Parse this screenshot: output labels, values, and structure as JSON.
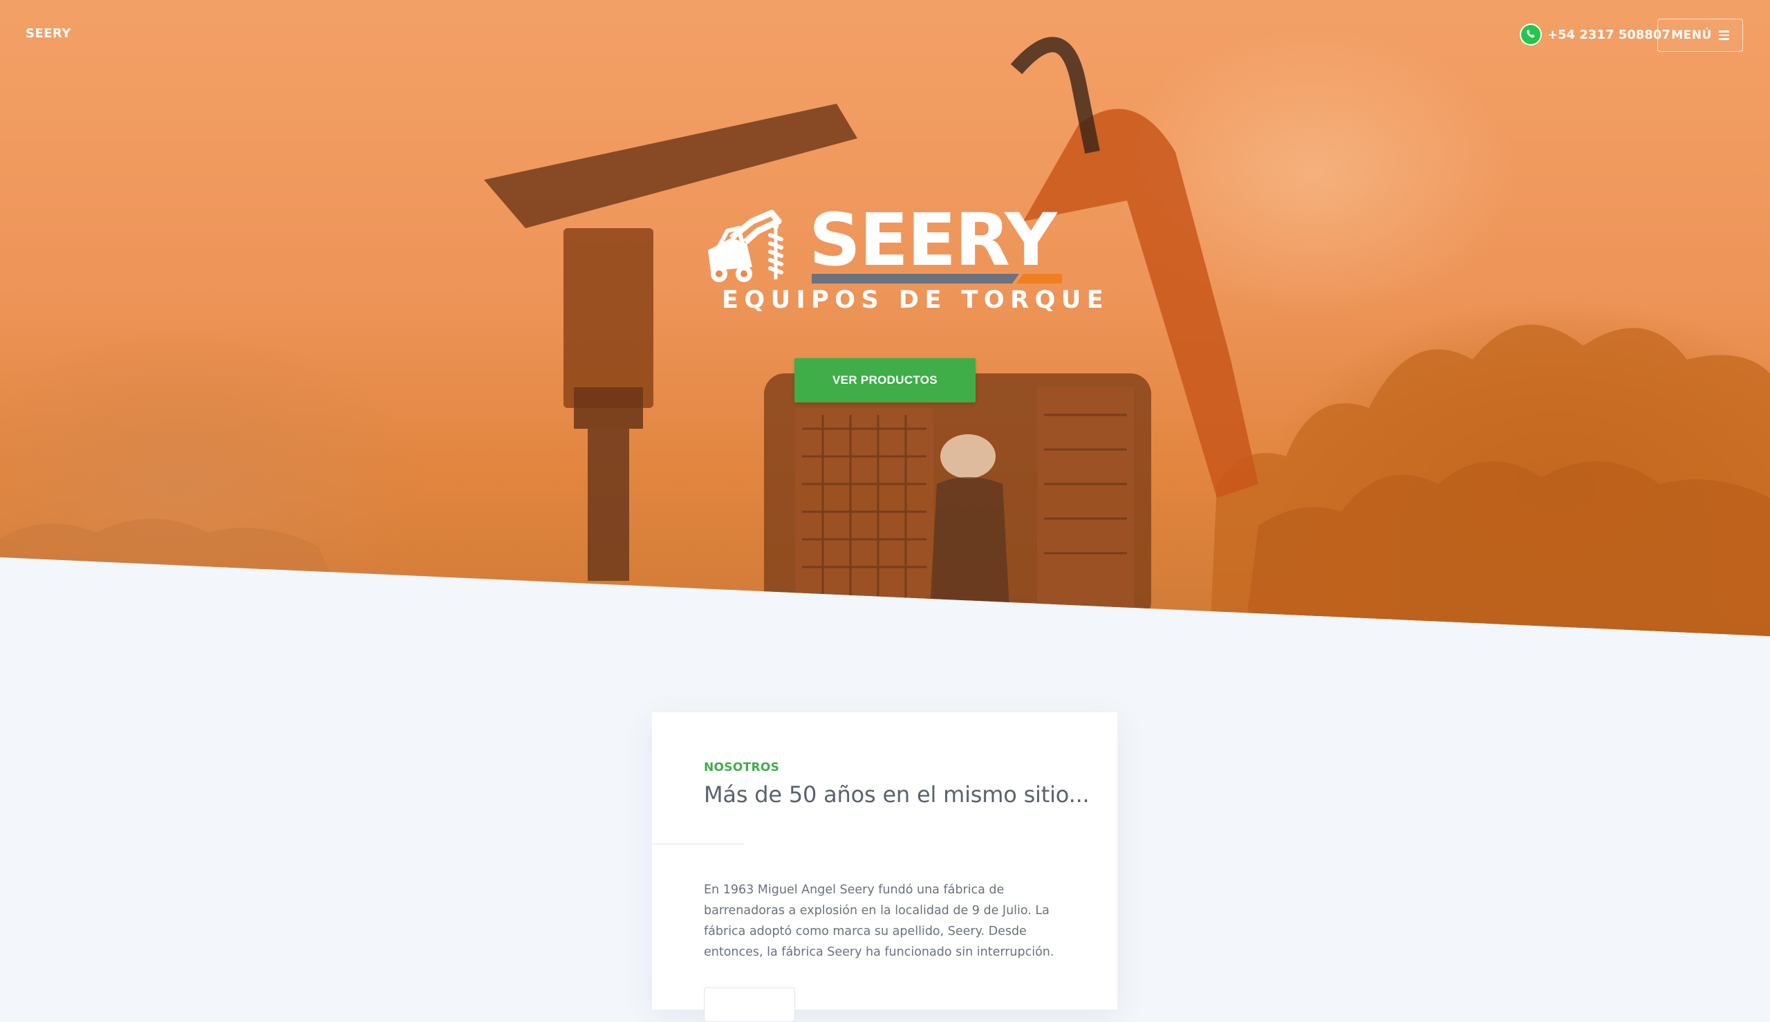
{
  "header": {
    "brand": "SEERY",
    "phone": "+54 2317 508807",
    "menu_label": "MENÚ"
  },
  "hero": {
    "logo_word": "SEERY",
    "logo_subtitle": "EQUIPOS DE TORQUE",
    "cta_label": "VER PRODUCTOS"
  },
  "about": {
    "eyebrow": "NOSOTROS",
    "title": "Más de 50 años en el mismo sitio...",
    "body": "En 1963 Miguel Angel Seery fundó una fábrica de barrenadoras a explosión en la localidad de 9 de Julio. La fábrica adoptó como marca su apellido, Seery. Desde entonces, la fábrica Seery ha funcionado sin interrupción."
  },
  "colors": {
    "overlay_orange": "#ee9559",
    "cta_green": "#3fae49",
    "logo_bar_gray": "#6b7280",
    "logo_bar_orange": "#f07f21",
    "page_bg": "#f3f6fa"
  },
  "icons": {
    "phone": "whatsapp-icon",
    "menu": "hamburger-icon",
    "logo": "skid-steer-auger-icon"
  }
}
